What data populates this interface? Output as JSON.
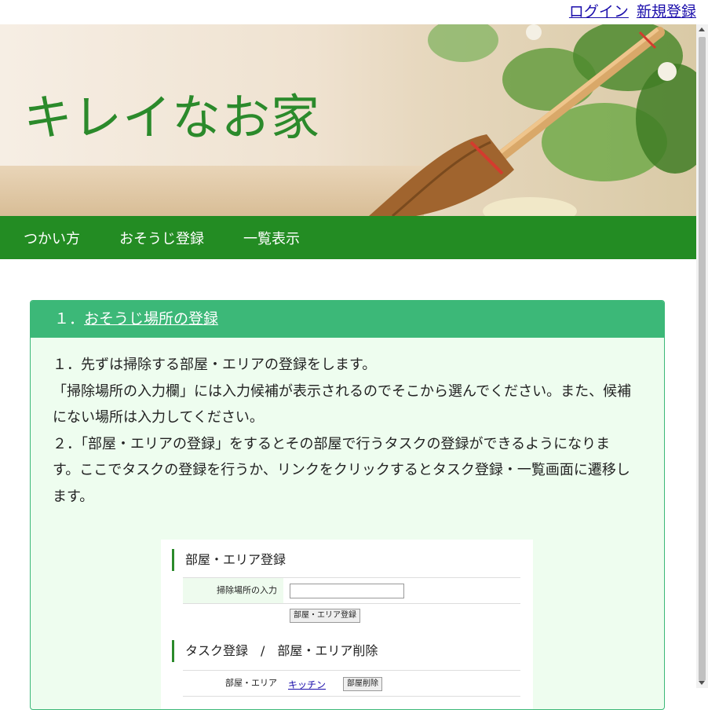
{
  "topbar": {
    "login": "ログイン",
    "register": "新規登録"
  },
  "hero": {
    "title": "キレイなお家"
  },
  "nav": {
    "items": [
      "つかい方",
      "おそうじ登録",
      "一覧表示"
    ]
  },
  "card": {
    "heading_num": "１．",
    "heading_link": "おそうじ場所の登録",
    "paragraphs": [
      "１．先ずは掃除する部屋・エリアの登録をします。",
      "「掃除場所の入力欄」には入力候補が表示されるのでそこから選んでください。また、候補にない場所は入力してください。",
      "２．「部屋・エリアの登録」をするとその部屋で行うタスクの登録ができるようになります。ここでタスクの登録を行うか、リンクをクリックするとタスク登録・一覧画面に遷移します。"
    ]
  },
  "screenshot": {
    "section1_title": "部屋・エリア登録",
    "field_label": "掃除場所の入力",
    "register_button": "部屋・エリア登録",
    "section2_title": "タスク登録　/　部屋・エリア削除",
    "room_label": "部屋・エリア",
    "room_link": "キッチン",
    "delete_button": "部屋削除"
  }
}
